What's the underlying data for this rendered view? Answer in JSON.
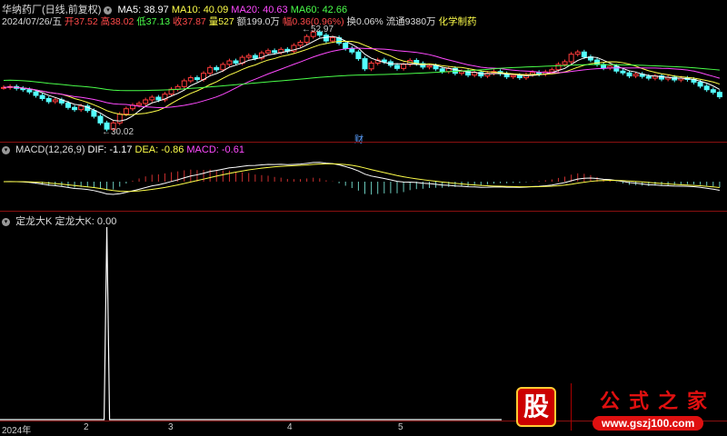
{
  "header": {
    "title": "华纳药厂(日线,前复权)",
    "ma5": "MA5: 38.97",
    "ma10": "MA10: 40.09",
    "ma20": "MA20: 40.63",
    "ma60": "MA60: 42.66"
  },
  "quote": {
    "date": "2024/07/26/五",
    "open": "开37.52",
    "high": "高38.02",
    "low": "低37.13",
    "close": "收37.87",
    "volume": "量527",
    "amount": "额199.0万",
    "change": "幅0.36(0.96%)",
    "turnover": "换0.06%",
    "float": "流通9380万",
    "industry": "化学制药"
  },
  "price_marks": {
    "high": "52.97",
    "low": "30.02",
    "finance": "财"
  },
  "macd": {
    "title": "MACD(12,26,9)",
    "dif": "DIF: -1.17",
    "dea": "DEA: -0.86",
    "macd": "MACD: -0.61"
  },
  "indicator": {
    "title": "定龙大K",
    "value": "定龙大K: 0.00"
  },
  "xaxis": [
    "2024年",
    "2",
    "3",
    "4",
    "5"
  ],
  "logo": {
    "char": "股",
    "name": "公式之家",
    "url": "www.gszj100.com"
  },
  "colors": {
    "up": "#ff3b3b",
    "down": "#54ffff",
    "ma5": "#ffffff",
    "ma10": "#ffff4a",
    "ma20": "#ff4aff",
    "ma60": "#4aff4a",
    "grid": "#8a1010"
  },
  "closes": [
    40,
    40.2,
    39.8,
    39.5,
    39,
    38.2,
    37.5,
    36.8,
    37.2,
    36.5,
    35.5,
    35,
    35.8,
    34.8,
    33.5,
    32,
    30.6,
    32,
    34,
    35.2,
    36,
    36.4,
    37.2,
    37.8,
    37.2,
    38.5,
    39.6,
    40.2,
    41.5,
    42.2,
    41.8,
    43.2,
    44.5,
    44,
    45.2,
    46,
    45.5,
    46.8,
    47.2,
    46.6,
    47.8,
    48.3,
    47.9,
    48.6,
    48.2,
    49.5,
    50.2,
    51.5,
    52.5,
    51.8,
    50.5,
    51.2,
    50,
    48.8,
    48,
    46.5,
    44.2,
    45.5,
    46.2,
    45.8,
    45,
    44.3,
    45.2,
    46.1,
    45.4,
    44.6,
    44.9,
    44.2,
    43.6,
    44.3,
    43.2,
    43.6,
    42.8,
    43.4,
    42.6,
    43.2,
    43.6,
    43.1,
    42.4,
    42.7,
    42.2,
    42.9,
    43.4,
    43,
    43.5,
    44,
    45.2,
    45.8,
    47.5,
    48,
    46.9,
    46.2,
    45.2,
    44.4,
    44.8,
    43.7,
    43.3,
    42.6,
    43,
    42.5,
    42.1,
    42.6,
    41.9,
    42.3,
    41.7,
    42.1,
    41.8,
    41.2,
    40.3,
    39.5,
    38.9,
    37.9
  ],
  "spike_index": 16
}
